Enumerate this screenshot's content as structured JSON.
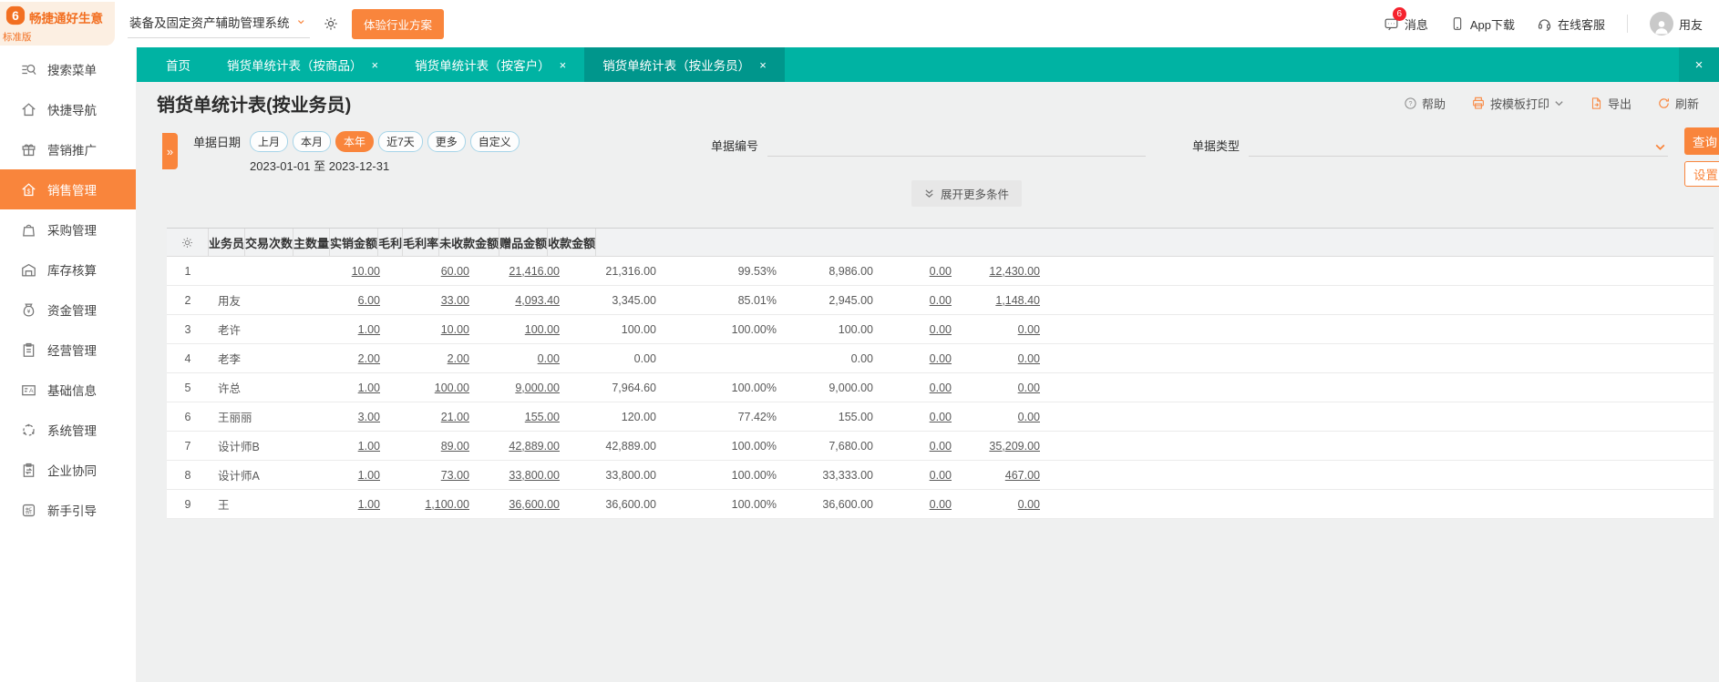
{
  "colors": {
    "teal": "#00B3A3",
    "teal_active_tab": "#00968C",
    "orange_accent": "#F9853C",
    "logo_orange": "#F26F21",
    "badge_red": "#F5222D"
  },
  "topbar": {
    "logo_title": "畅捷通好生意",
    "logo_subtitle": "标准版",
    "system_select_value": "装备及固定资产辅助管理系统",
    "trial_button": "体验行业方案",
    "message_label": "消息",
    "message_badge": "6",
    "app_download_label": "App下载",
    "online_service_label": "在线客服",
    "username": "用友",
    "icons": [
      "logo-icon",
      "chevron-down-icon",
      "gear-icon",
      "message-icon",
      "phone-icon",
      "headset-icon",
      "avatar"
    ]
  },
  "tabbar": {
    "tabs": [
      {
        "label": "首页",
        "closable": false,
        "active": false
      },
      {
        "label": "销货单统计表（按商品）",
        "closable": true,
        "active": false
      },
      {
        "label": "销货单统计表（按客户）",
        "closable": true,
        "active": false
      },
      {
        "label": "销货单统计表（按业务员）",
        "closable": true,
        "active": true
      }
    ],
    "close_all": "×"
  },
  "sidebar": {
    "items": [
      {
        "label": "搜索菜单",
        "icon": "search",
        "icon_name": "search-menu-icon",
        "active": false
      },
      {
        "label": "快捷导航",
        "icon": "home",
        "icon_name": "quick-nav-icon",
        "active": false
      },
      {
        "label": "营销推广",
        "icon": "gift",
        "icon_name": "marketing-icon",
        "active": false
      },
      {
        "label": "销售管理",
        "icon": "sales",
        "icon_name": "sales-icon",
        "active": true
      },
      {
        "label": "采购管理",
        "icon": "purchase",
        "icon_name": "purchase-icon",
        "active": false
      },
      {
        "label": "库存核算",
        "icon": "inventory",
        "icon_name": "inventory-icon",
        "active": false
      },
      {
        "label": "资金管理",
        "icon": "funds",
        "icon_name": "funds-icon",
        "active": false
      },
      {
        "label": "经营管理",
        "icon": "operate",
        "icon_name": "operations-icon",
        "active": false
      },
      {
        "label": "基础信息",
        "icon": "baseinfo",
        "icon_name": "base-info-icon",
        "active": false
      },
      {
        "label": "系统管理",
        "icon": "system",
        "icon_name": "system-icon",
        "active": false
      },
      {
        "label": "企业协同",
        "icon": "collab",
        "icon_name": "collaboration-icon",
        "active": false
      },
      {
        "label": "新手引导",
        "icon": "guide",
        "icon_name": "beginner-guide-icon",
        "active": false
      }
    ]
  },
  "page": {
    "title": "销货单统计表(按业务员)",
    "toolbar": {
      "help": "帮助",
      "print": "按模板打印",
      "export": "导出",
      "refresh": "刷新"
    }
  },
  "filters": {
    "date_label": "单据日期",
    "date_pills": [
      {
        "label": "上月",
        "selected": false
      },
      {
        "label": "本月",
        "selected": false
      },
      {
        "label": "本年",
        "selected": true
      },
      {
        "label": "近7天",
        "selected": false
      },
      {
        "label": "更多",
        "selected": false
      },
      {
        "label": "自定义",
        "selected": false
      }
    ],
    "date_range": "2023-01-01 至 2023-12-31",
    "bill_no_label": "单据编号",
    "bill_no_value": "",
    "bill_type_label": "单据类型",
    "bill_type_value": "",
    "query_button": "查询",
    "settings_button": "设置",
    "expand_more": "展开更多条件"
  },
  "table": {
    "columns": [
      "业务员",
      "交易次数",
      "主数量",
      "实销金额",
      "毛利",
      "毛利率",
      "未收款金额",
      "赠品金额",
      "收款金额"
    ],
    "rows": [
      {
        "no": "1",
        "name": "",
        "values": [
          "10.00",
          "60.00",
          "21,416.00",
          "21,316.00",
          "99.53%",
          "8,986.00",
          "0.00",
          "12,430.00"
        ]
      },
      {
        "no": "2",
        "name": "用友",
        "values": [
          "6.00",
          "33.00",
          "4,093.40",
          "3,345.00",
          "85.01%",
          "2,945.00",
          "0.00",
          "1,148.40"
        ]
      },
      {
        "no": "3",
        "name": "老许",
        "values": [
          "1.00",
          "10.00",
          "100.00",
          "100.00",
          "100.00%",
          "100.00",
          "0.00",
          "0.00"
        ]
      },
      {
        "no": "4",
        "name": "老李",
        "values": [
          "2.00",
          "2.00",
          "0.00",
          "0.00",
          "",
          "0.00",
          "0.00",
          "0.00"
        ]
      },
      {
        "no": "5",
        "name": "许总",
        "values": [
          "1.00",
          "100.00",
          "9,000.00",
          "7,964.60",
          "100.00%",
          "9,000.00",
          "0.00",
          "0.00"
        ]
      },
      {
        "no": "6",
        "name": "王丽丽",
        "values": [
          "3.00",
          "21.00",
          "155.00",
          "120.00",
          "77.42%",
          "155.00",
          "0.00",
          "0.00"
        ]
      },
      {
        "no": "7",
        "name": "设计师B",
        "values": [
          "1.00",
          "89.00",
          "42,889.00",
          "42,889.00",
          "100.00%",
          "7,680.00",
          "0.00",
          "35,209.00"
        ]
      },
      {
        "no": "8",
        "name": "设计师A",
        "values": [
          "1.00",
          "73.00",
          "33,800.00",
          "33,800.00",
          "100.00%",
          "33,333.00",
          "0.00",
          "467.00"
        ]
      },
      {
        "no": "9",
        "name": "王",
        "values": [
          "1.00",
          "1,100.00",
          "36,600.00",
          "36,600.00",
          "100.00%",
          "36,600.00",
          "0.00",
          "0.00"
        ]
      }
    ]
  }
}
